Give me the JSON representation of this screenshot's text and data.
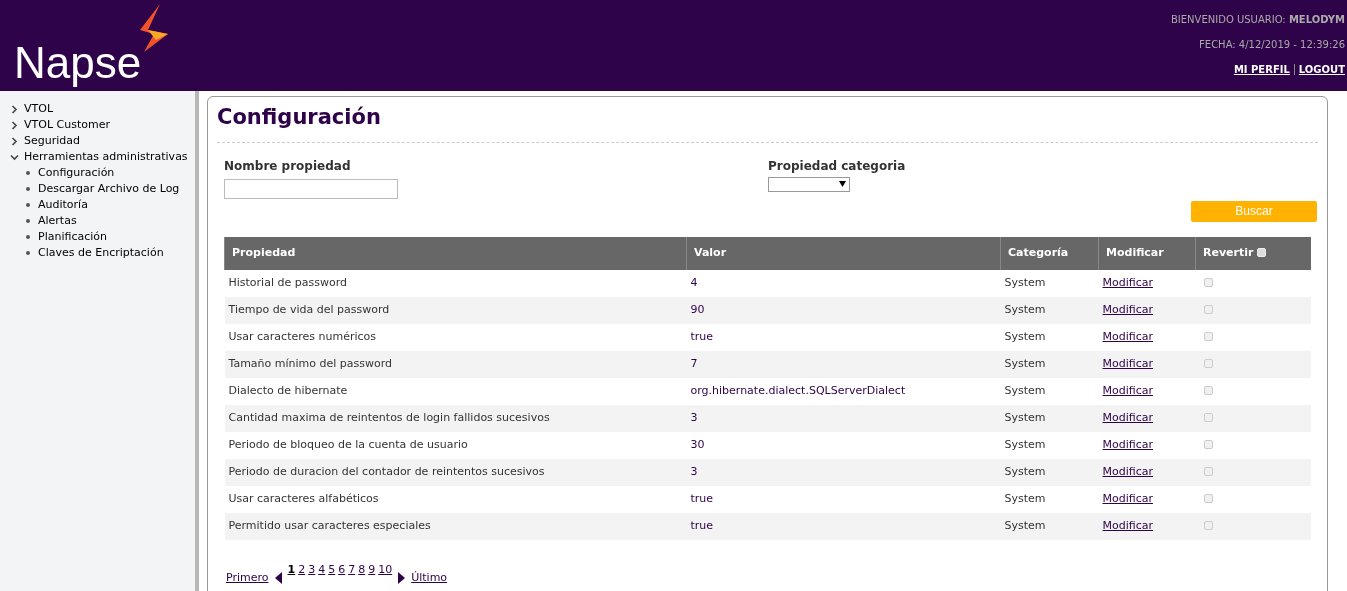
{
  "header": {
    "logo": "Napse",
    "welcome_label": "BIENVENIDO USUARIO:",
    "user": "MELODYM",
    "date": "FECHA: 4/12/2019 - 12:39:26",
    "links": [
      "MI PERFIL",
      "LOGOUT"
    ]
  },
  "sidebar": {
    "items": [
      {
        "label": "VTOL",
        "expanded": false
      },
      {
        "label": "VTOL Customer",
        "expanded": false
      },
      {
        "label": "Seguridad",
        "expanded": false
      },
      {
        "label": "Herramientas administrativas",
        "expanded": true,
        "children": [
          {
            "label": "Configuración"
          },
          {
            "label": "Descargar Archivo de Log"
          },
          {
            "label": "Auditoría"
          },
          {
            "label": "Alertas"
          },
          {
            "label": "Planificación"
          },
          {
            "label": "Claves de Encriptación"
          }
        ]
      }
    ]
  },
  "page_title": "Configuración",
  "filters": {
    "name_label": "Nombre propiedad",
    "category_label": "Propiedad categoria",
    "search_button": "Buscar"
  },
  "table": {
    "columns": [
      "Propiedad",
      "Valor",
      "Categoría",
      "Modificar",
      "Revertir"
    ],
    "select_all_checked": false,
    "rows": [
      {
        "property": "Historial de password",
        "value": "4",
        "category": "System",
        "action": "Modificar",
        "checked": false
      },
      {
        "property": "Tiempo de vida del password",
        "value": "90",
        "category": "System",
        "action": "Modificar",
        "checked": false
      },
      {
        "property": "Usar caracteres numéricos",
        "value": "true",
        "category": "System",
        "action": "Modificar",
        "checked": false
      },
      {
        "property": "Tamaño mínimo del password",
        "value": "7",
        "category": "System",
        "action": "Modificar",
        "checked": false
      },
      {
        "property": "Dialecto de hibernate",
        "value": "org.hibernate.dialect.SQLServerDialect",
        "category": "System",
        "action": "Modificar",
        "checked": false
      },
      {
        "property": "Cantidad maxima de reintentos de login fallidos sucesivos",
        "value": "3",
        "category": "System",
        "action": "Modificar",
        "checked": false
      },
      {
        "property": "Periodo de bloqueo de la cuenta de usuario",
        "value": "30",
        "category": "System",
        "action": "Modificar",
        "checked": false
      },
      {
        "property": "Periodo de duracion del contador de reintentos sucesivos",
        "value": "3",
        "category": "System",
        "action": "Modificar",
        "checked": false
      },
      {
        "property": "Usar caracteres alfabéticos",
        "value": "true",
        "category": "System",
        "action": "Modificar",
        "checked": false
      },
      {
        "property": "Permitido usar caracteres especiales",
        "value": "true",
        "category": "System",
        "action": "Modificar",
        "checked": false
      }
    ]
  },
  "pagination": {
    "first": "Primero",
    "last": "Último",
    "pages": [
      {
        "label": "1",
        "selected": true
      },
      {
        "label": "2",
        "selected": false
      },
      {
        "label": "3",
        "selected": false
      },
      {
        "label": "4",
        "selected": false
      },
      {
        "label": "5",
        "selected": false
      },
      {
        "label": "6",
        "selected": false
      },
      {
        "label": "7",
        "selected": false
      },
      {
        "label": "8",
        "selected": false
      },
      {
        "label": "9",
        "selected": false
      },
      {
        "label": "10",
        "selected": false
      }
    ]
  }
}
